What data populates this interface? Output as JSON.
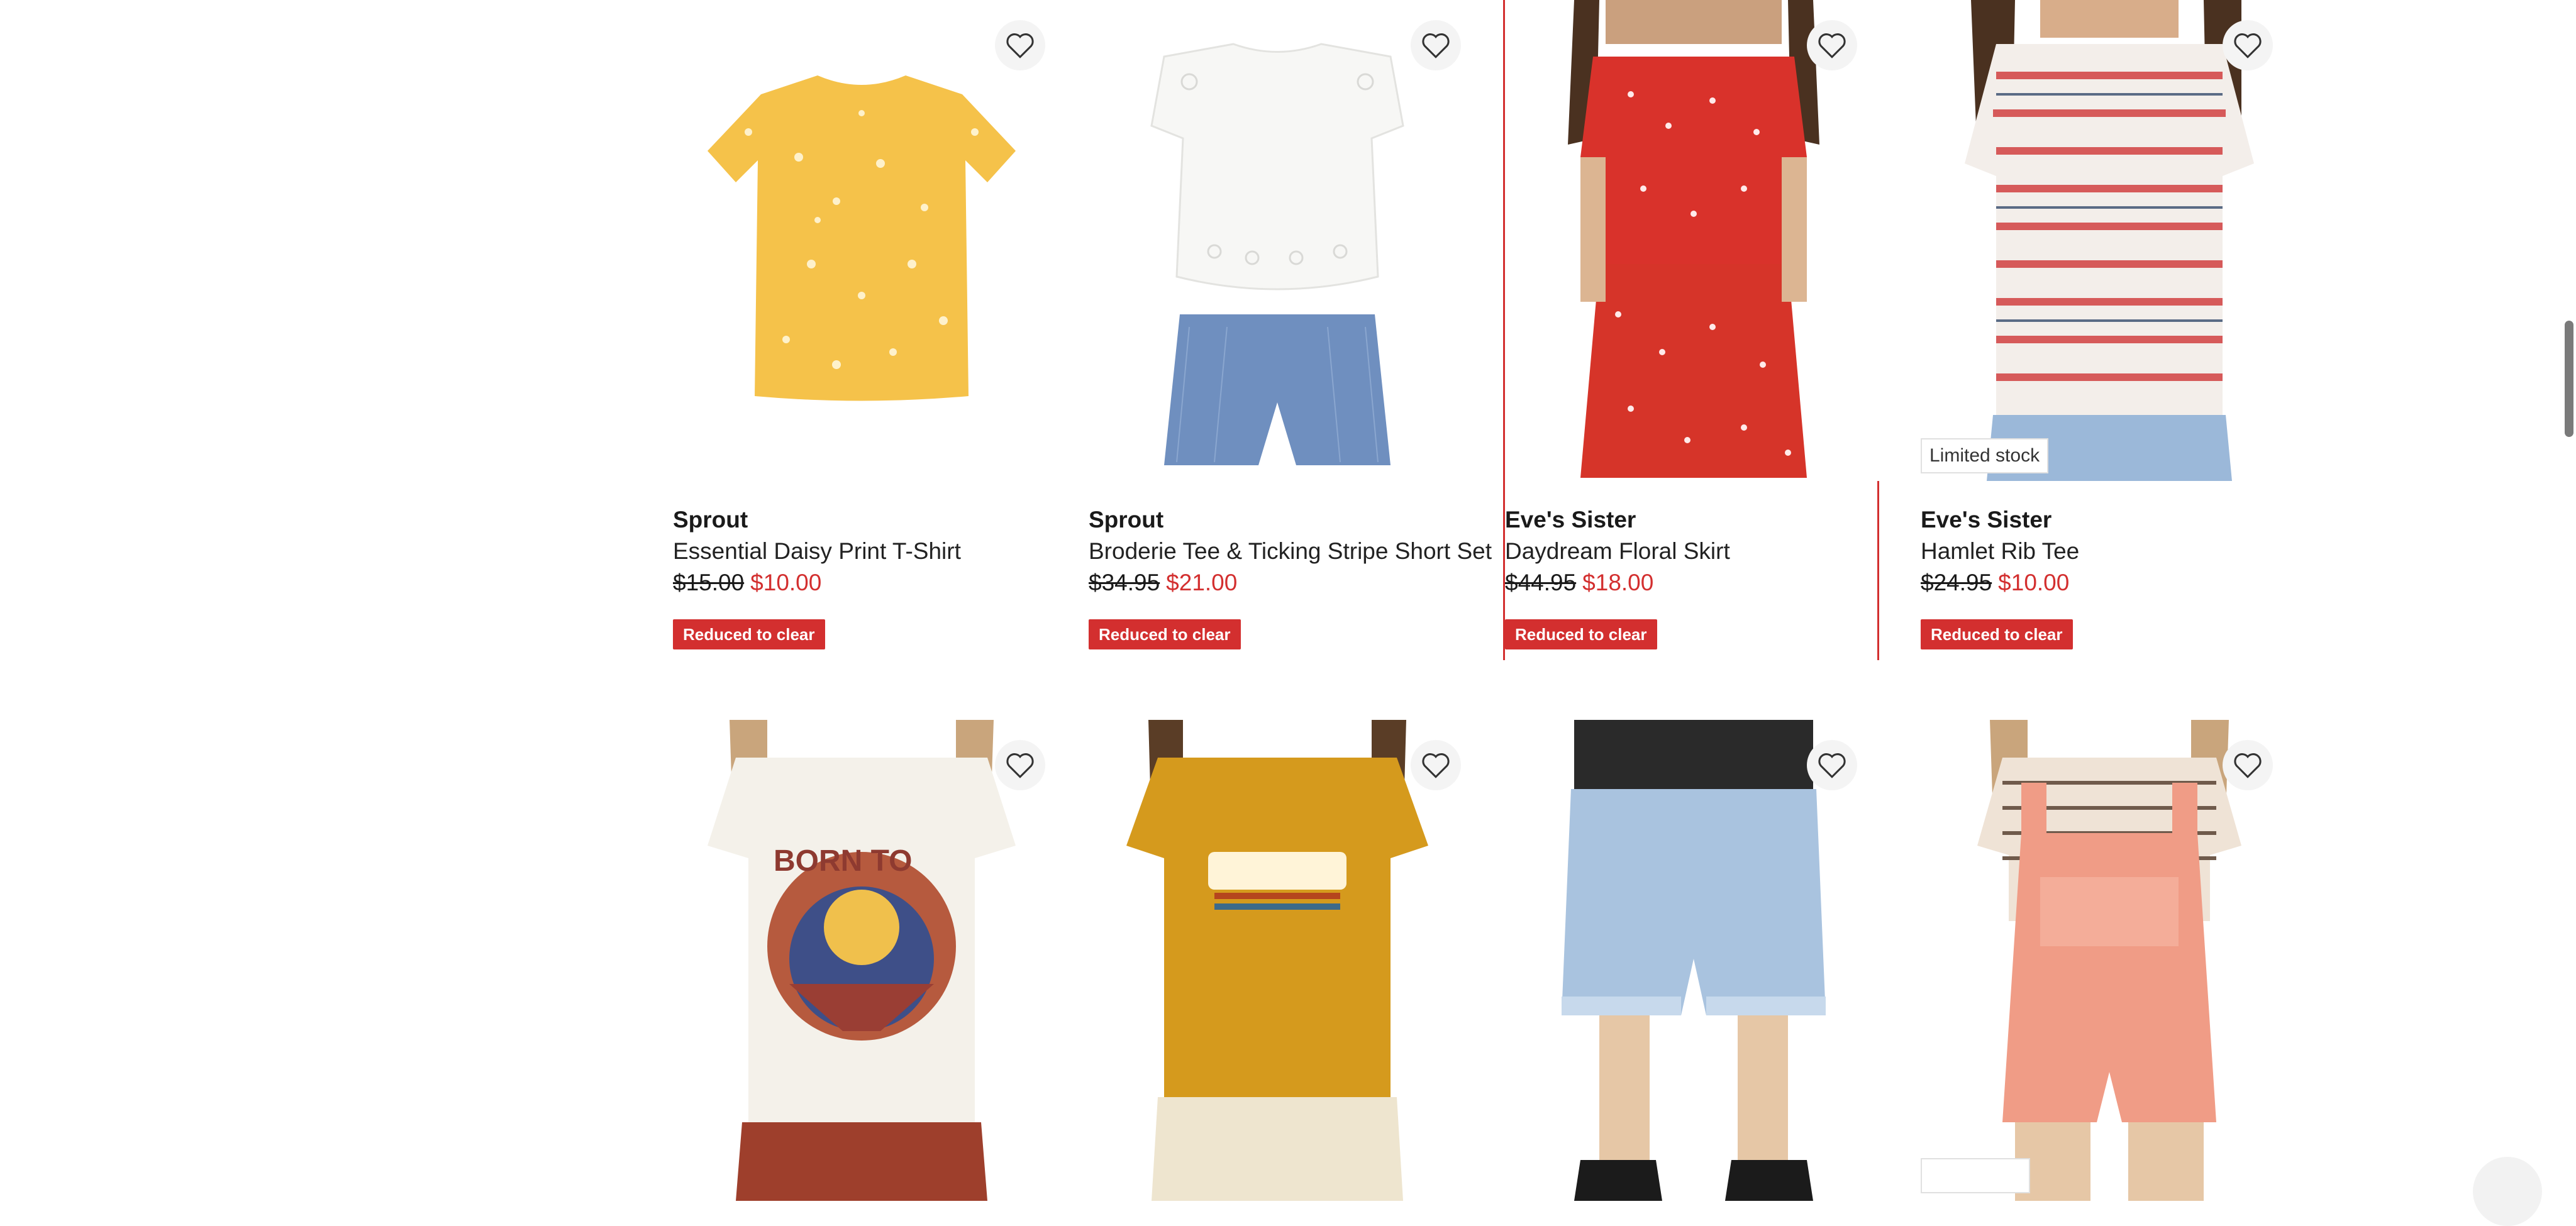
{
  "products_row1": [
    {
      "brand": "Sprout",
      "name": "Essential Daisy Print T-Shirt",
      "was": "$15.00",
      "now": "$10.00",
      "tag": "Reduced to clear",
      "image": "yellow daisy t-shirt",
      "badge": ""
    },
    {
      "brand": "Sprout",
      "name": "Broderie Tee & Ticking Stripe Short Set",
      "was": "$34.95",
      "now": "$21.00",
      "tag": "Reduced to clear",
      "image": "white broderie tee with chambray shorts",
      "badge": ""
    },
    {
      "brand": "Eve's Sister",
      "name": "Daydream Floral Skirt",
      "was": "$44.95",
      "now": "$18.00",
      "tag": "Reduced to clear",
      "image": "red floral skirt on model",
      "badge": ""
    },
    {
      "brand": "Eve's Sister",
      "name": "Hamlet Rib Tee",
      "was": "$24.95",
      "now": "$10.00",
      "tag": "Reduced to clear",
      "image": "striped rib tee on model",
      "badge": "Limited stock"
    }
  ],
  "products_row2": [
    {
      "image": "white graphic tee born to roam"
    },
    {
      "image": "mustard tee desert bound"
    },
    {
      "image": "denim shorts on model"
    },
    {
      "image": "pink overalls on model"
    }
  ],
  "icons": {
    "wishlist": "heart-outline-icon"
  },
  "colors": {
    "sale_red": "#d32f2f",
    "text": "#1a1a1a"
  }
}
